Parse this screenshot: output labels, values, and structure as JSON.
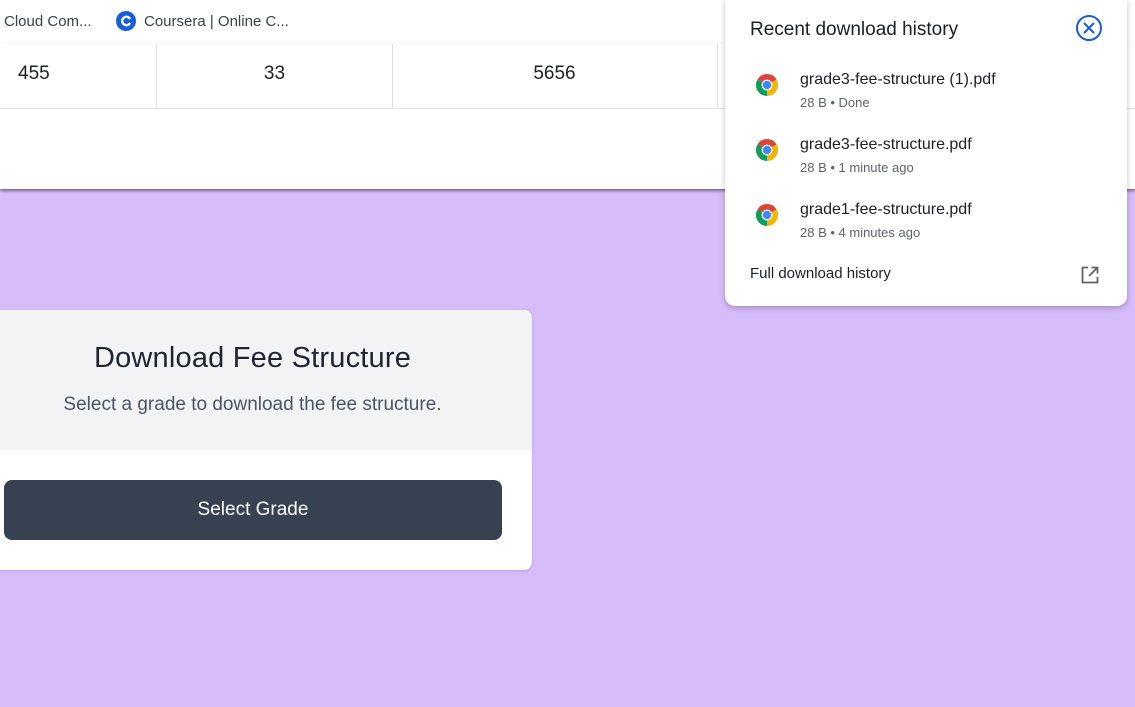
{
  "bookmarks": [
    {
      "label": "Cloud Com...",
      "icon": "none"
    },
    {
      "label": "Coursera | Online C...",
      "icon": "coursera-icon"
    }
  ],
  "table": {
    "cells": [
      "455",
      "33",
      "5656",
      ""
    ]
  },
  "card": {
    "title": "Download Fee Structure",
    "subtitle": "Select a grade to download the fee structure.",
    "button_label": "Select Grade"
  },
  "downloads": {
    "title": "Recent download history",
    "items": [
      {
        "name": "grade3-fee-structure (1).pdf",
        "meta": "28 B • Done",
        "icon": "chrome-icon"
      },
      {
        "name": "grade3-fee-structure.pdf",
        "meta": "28 B • 1 minute ago",
        "icon": "chrome-icon"
      },
      {
        "name": "grade1-fee-structure.pdf",
        "meta": "28 B • 4 minutes ago",
        "icon": "chrome-icon"
      }
    ],
    "full_history_label": "Full download history"
  },
  "colors": {
    "page_background": "#d7bcfa",
    "button": "#374151",
    "close_icon": "#1a5ddb"
  }
}
